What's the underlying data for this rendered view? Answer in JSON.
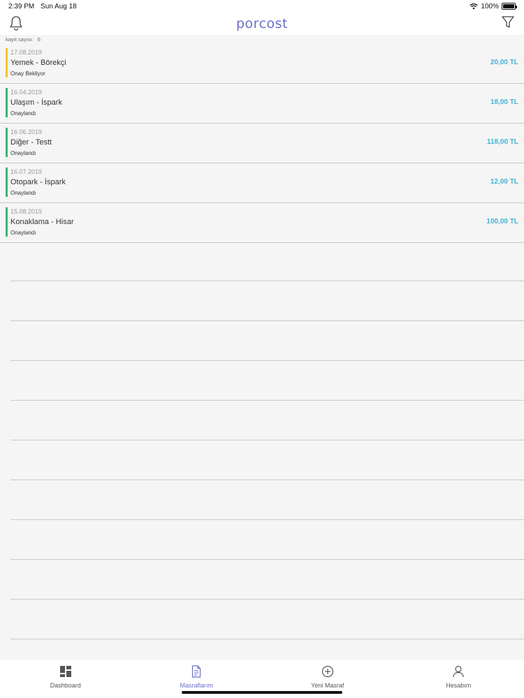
{
  "status_bar": {
    "time": "2:39 PM",
    "date": "Sun Aug 18",
    "battery": "100%",
    "battery_level": 1.0
  },
  "header": {
    "brand": "porcost",
    "left_icon": "bell-icon",
    "right_icon": "filter-icon"
  },
  "summary": {
    "label": "kayıt sayısı:",
    "count": "6"
  },
  "colors": {
    "accent": "#6b6ec9",
    "amount": "#3fb3dc",
    "pending": "#f2c531",
    "approved": "#3cb56b"
  },
  "expenses": [
    {
      "date": "17.08.2019",
      "title": "Yemek - Börekçi",
      "status": "Onay Bekliyor",
      "amount": "20,00 TL",
      "state": "pending"
    },
    {
      "date": "16.04.2019",
      "title": "Ulaşım - İspark",
      "status": "Onaylandı",
      "amount": "18,00 TL",
      "state": "approved"
    },
    {
      "date": "16.06.2019",
      "title": "Diğer - Testt",
      "status": "Onaylandı",
      "amount": "118,00 TL",
      "state": "approved"
    },
    {
      "date": "16.07.2019",
      "title": "Otopark - İspark",
      "status": "Onaylandı",
      "amount": "12,00 TL",
      "state": "approved"
    },
    {
      "date": "15.08.2019",
      "title": "Konaklama - Hisar",
      "status": "Onaylandı",
      "amount": "100,00 TL",
      "state": "approved"
    }
  ],
  "tabs": [
    {
      "label": "Dashboard",
      "icon": "dashboard-icon",
      "active": false
    },
    {
      "label": "Masraflarım",
      "icon": "document-icon",
      "active": true
    },
    {
      "label": "Yeni Masraf",
      "icon": "plus-circle-icon",
      "active": false
    },
    {
      "label": "Hesabım",
      "icon": "person-icon",
      "active": false
    }
  ]
}
